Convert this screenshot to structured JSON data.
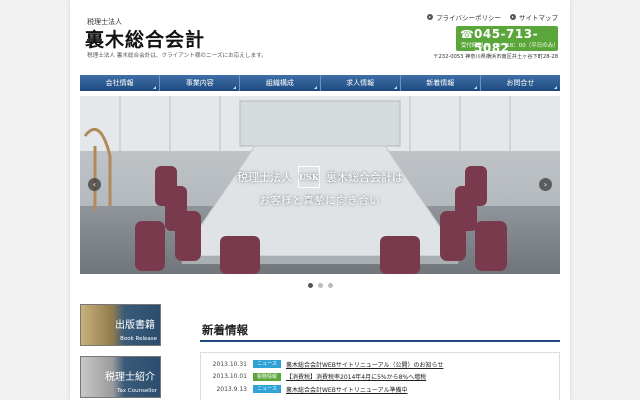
{
  "header": {
    "small_label": "税理士法人",
    "logo": "裏木総合会計",
    "tagline": "税理士法人 裏木総合会計は、クライアント様のニーズにお応えします。",
    "links": [
      {
        "label": "プライバシーポリシー",
        "icon": "arrow-circle-icon"
      },
      {
        "label": "サイトマップ",
        "icon": "arrow-circle-icon"
      }
    ],
    "phone": {
      "icon": "phone-icon",
      "number": "045-713-5082",
      "hours": "受付時間 9：00〜18：00（平日のみ）",
      "color": "#5aa63a"
    },
    "address": "〒232-0053 神奈川県横浜市南区井土ヶ谷下町28-28"
  },
  "nav": {
    "color": "#1e4a80",
    "items": [
      "会社情報",
      "事業内容",
      "組織構成",
      "求人情報",
      "新着情報",
      "お問合せ"
    ]
  },
  "hero": {
    "line1_prefix": "税理士法人",
    "mark": "USK",
    "line1_suffix": "裏木総合会計は",
    "line2": "お客様と真摯に向き合い",
    "prev": "‹",
    "next": "›",
    "slides": 3,
    "active_slide": 1
  },
  "sidebar": {
    "banners": [
      {
        "title": "出版書籍",
        "sub": "Book Release"
      },
      {
        "title": "税理士紹介",
        "sub": "Tax Counsellor"
      }
    ]
  },
  "news": {
    "title": "新着情報",
    "items": [
      {
        "date": "2013.10.31",
        "badge": "ニュース",
        "badge_color": "#2fa3d6",
        "text": "裏木総合会計WEBサイトリニューアル（公開）のお知らせ"
      },
      {
        "date": "2013.10.01",
        "badge": "税務情報",
        "badge_color": "#5aa63a",
        "text": "【消費税】消費税率2014年4月に5%から8%へ増税"
      },
      {
        "date": "2013.9.13",
        "badge": "ニュース",
        "badge_color": "#2fa3d6",
        "text": "裏木総合会計WEBサイトリニューアル準備中"
      }
    ]
  }
}
